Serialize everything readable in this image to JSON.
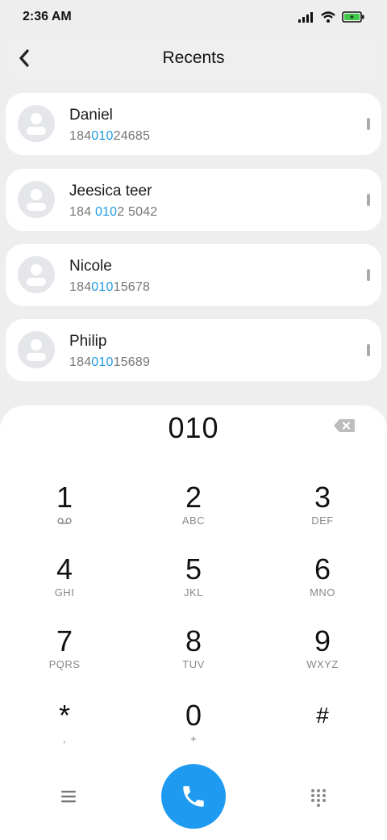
{
  "status_bar": {
    "time": "2:36 AM"
  },
  "header": {
    "title": "Recents"
  },
  "recents": [
    {
      "name": "Daniel",
      "number_pre": "184",
      "number_match": "010",
      "number_post": "24685"
    },
    {
      "name": "Jeesica teer",
      "number_pre": "184 ",
      "number_match": "010",
      "number_post": "2 5042"
    },
    {
      "name": "Nicole",
      "number_pre": "184",
      "number_match": "010",
      "number_post": "15678"
    },
    {
      "name": "Philip",
      "number_pre": "184",
      "number_match": "010",
      "number_post": "15689"
    }
  ],
  "dialer": {
    "input_value": "010",
    "keys": [
      {
        "digit": "1",
        "sub": ""
      },
      {
        "digit": "2",
        "sub": "ABC"
      },
      {
        "digit": "3",
        "sub": "DEF"
      },
      {
        "digit": "4",
        "sub": "GHI"
      },
      {
        "digit": "5",
        "sub": "JKL"
      },
      {
        "digit": "6",
        "sub": "MNO"
      },
      {
        "digit": "7",
        "sub": "PQRS"
      },
      {
        "digit": "8",
        "sub": "TUV"
      },
      {
        "digit": "9",
        "sub": "WXYZ"
      },
      {
        "digit": "*",
        "sub": ","
      },
      {
        "digit": "0",
        "sub": "+"
      },
      {
        "digit": "#",
        "sub": ""
      }
    ]
  },
  "icons": {
    "back": "chevron-left-icon",
    "backspace": "backspace-icon",
    "voicemail": "voicemail-icon",
    "menu": "menu-icon",
    "call": "phone-icon",
    "keypad": "dialpad-icon",
    "signal": "signal-icon",
    "wifi": "wifi-icon",
    "battery": "battery-charging-icon"
  },
  "colors": {
    "accent": "#1e9bf0",
    "highlight": "#1e9be6",
    "battery": "#3fc94a"
  }
}
